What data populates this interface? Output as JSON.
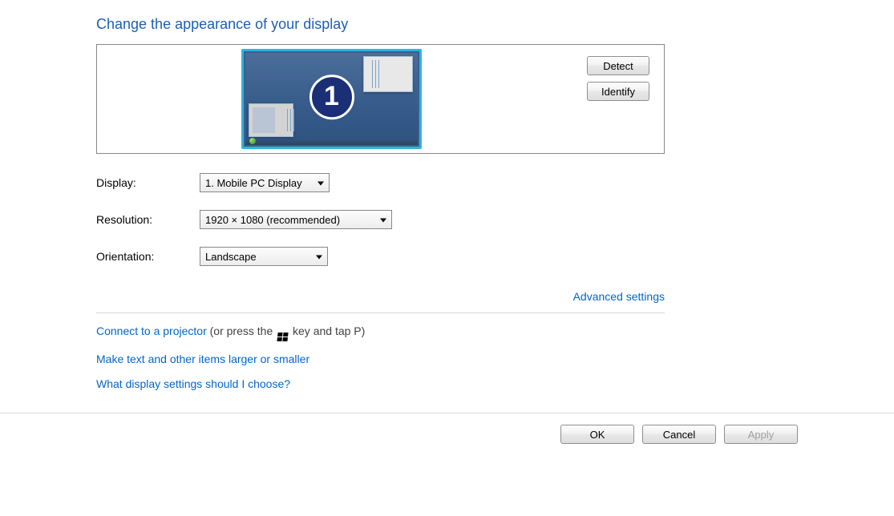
{
  "title": "Change the appearance of your display",
  "monitor_number": "1",
  "buttons": {
    "detect": "Detect",
    "identify": "Identify",
    "ok": "OK",
    "cancel": "Cancel",
    "apply": "Apply"
  },
  "form": {
    "display_label": "Display:",
    "display_value": "1. Mobile PC Display",
    "resolution_label": "Resolution:",
    "resolution_value": "1920 × 1080 (recommended)",
    "orientation_label": "Orientation:",
    "orientation_value": "Landscape"
  },
  "links": {
    "advanced": "Advanced settings",
    "projector": "Connect to a projector",
    "projector_suffix_a": " (or press the ",
    "projector_suffix_b": " key and tap P)",
    "text_size": "Make text and other items larger or smaller",
    "help": "What display settings should I choose?"
  }
}
